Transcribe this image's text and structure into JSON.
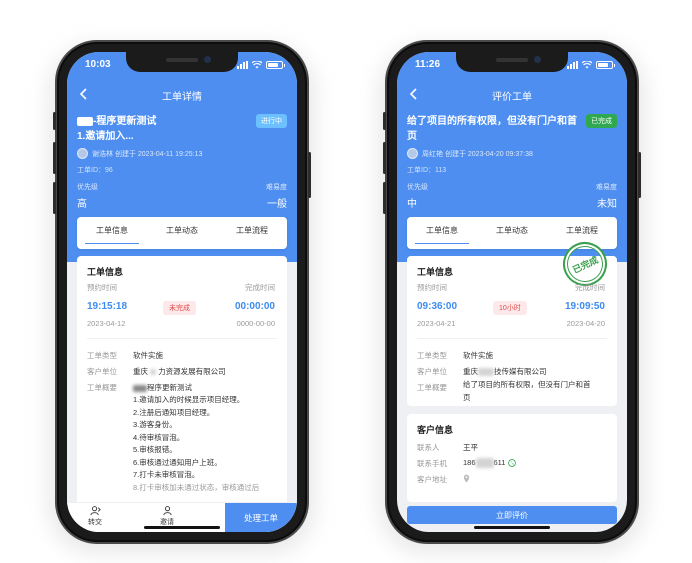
{
  "left": {
    "time": "10:03",
    "nav_title": "工单详情",
    "ticket_title": "-程序更新测试",
    "ticket_subtitle": "1.邀请加入...",
    "status_badge": "进行中",
    "creator": "谢浩林 创建于 2023-04-11 19:25:13",
    "ticket_id": "工单ID：96",
    "priority_label": "优先级",
    "priority_value": "高",
    "difficulty_label": "难易度",
    "difficulty_value": "一般",
    "tabs": [
      "工单信息",
      "工单动态",
      "工单流程"
    ],
    "section_title": "工单信息",
    "reserve_label": "预约时间",
    "reserve_time": "19:15:18",
    "reserve_date": "2023-04-12",
    "duration_status": "未完成",
    "complete_label": "完成时间",
    "complete_time": "00:00:00",
    "complete_date": "0000-00-00",
    "type_label": "工单类型",
    "type_value": "软件实施",
    "client_label": "客户单位",
    "client_value_a": "重庆",
    "client_value_b": "力资源发展有限公司",
    "summary_label": "工单概要",
    "summary_title": "程序更新测试",
    "summary_lines": [
      "1.邀请加入的时候显示项目经理。",
      "2.注册后通知项目经理。",
      "3.游客身份。",
      "4.待审核冒泡。",
      "5.审核报错。",
      "6.审核通过通知用户上班。",
      "7.打卡未审核冒泡。",
      "8.打卡审核加未通过状态，审核通过后"
    ],
    "bottom_transfer": "转交",
    "bottom_invite": "邀请",
    "bottom_action": "处理工单"
  },
  "right": {
    "time": "11:26",
    "nav_title": "评价工单",
    "ticket_title": "给了项目的所有权限，但没有门户和首页",
    "status_badge": "已完成",
    "creator": "周红艳 创建于 2023-04-20 09:37:38",
    "ticket_id": "工单ID：113",
    "priority_label": "优先级",
    "priority_value": "中",
    "difficulty_label": "难易度",
    "difficulty_value": "未知",
    "tabs": [
      "工单信息",
      "工单动态",
      "工单流程"
    ],
    "stamp": "已完成",
    "section_title": "工单信息",
    "reserve_label": "预约时间",
    "reserve_time": "09:36:00",
    "reserve_date": "2023-04-21",
    "duration": "10小时",
    "complete_label": "完成时间",
    "complete_time": "19:09:50",
    "complete_date": "2023-04-20",
    "type_label": "工单类型",
    "type_value": "软件实施",
    "client_label": "客户单位",
    "client_value_a": "重庆",
    "client_value_b": "技传媒有限公司",
    "summary_label": "工单概要",
    "summary_lines": [
      "给了项目的所有权限，但没有门户和首",
      "页"
    ],
    "customer_title": "客户信息",
    "contact_label": "联系人",
    "contact_value": "王平",
    "phone_label": "联系手机",
    "phone_prefix": "186",
    "phone_suffix": "611",
    "address_label": "客户地址",
    "bottom_action": "立即评价"
  },
  "colors": {
    "primary": "#4d8ef0",
    "done_green": "#2fa84f",
    "warn_red": "#e04b4b"
  }
}
